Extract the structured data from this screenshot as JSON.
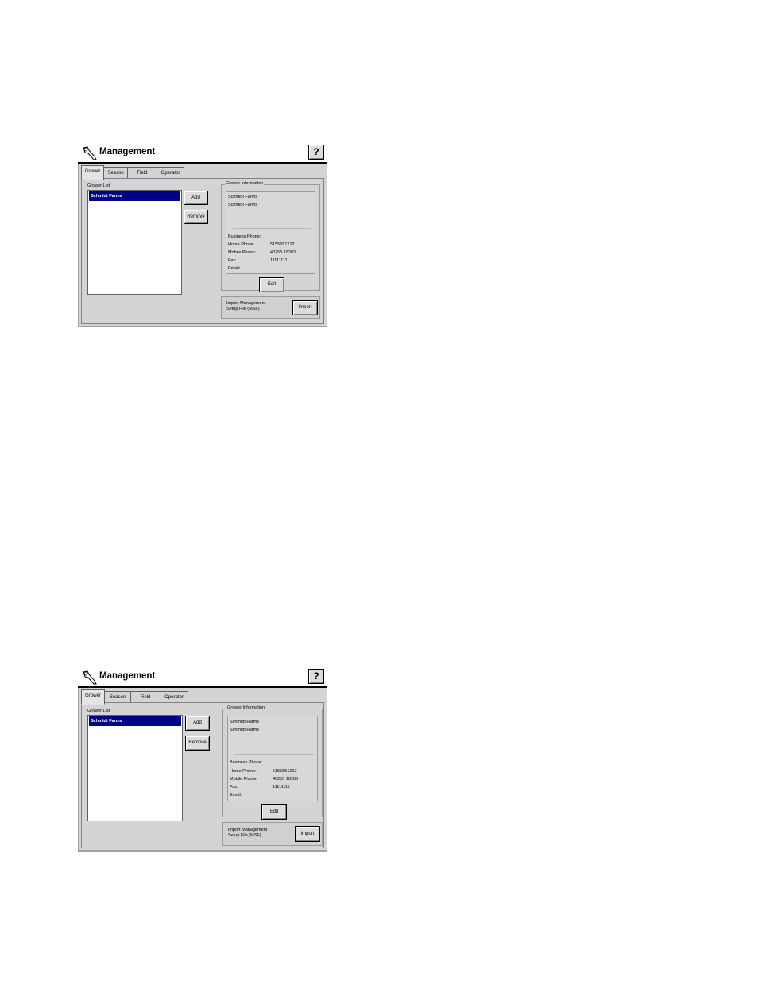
{
  "screens": [
    {
      "title": "Management",
      "help_label": "?",
      "tabs": [
        "Grower",
        "Season",
        "Field",
        "Operator"
      ],
      "grower_list_label": "Grower List",
      "grower_list": [
        "Schmidt Farms"
      ],
      "add_label": "Add",
      "remove_label": "Remove",
      "grower_info_label": "Grower Information",
      "info_name_1": "Schmidt Farms",
      "info_name_2": "Schmidt Farms",
      "business_phone_label": "Business Phone:",
      "home_phone_label": "Home Phone:",
      "home_phone_value": "5155551212",
      "mobile_phone_label": "Mobile Phone:",
      "mobile_phone_value": "40255 18283",
      "fax_label": "Fax:",
      "fax_value": "11111111",
      "email_label": "Email:",
      "edit_label": "Edit",
      "import_text_1": "Import Management",
      "import_text_2": "Setup File (MSF)",
      "import_label": "Import"
    },
    {
      "title": "Management",
      "help_label": "?",
      "tabs": [
        "Grower",
        "Season",
        "Field",
        "Operator"
      ],
      "grower_list_label": "Grower List",
      "grower_list": [
        "Schmidt Farms"
      ],
      "add_label": "Add",
      "remove_label": "Remove",
      "grower_info_label": "Grower Information",
      "info_name_1": "Schmidt Farms",
      "info_name_2": "Schmidt Farms",
      "business_phone_label": "Business Phone:",
      "home_phone_label": "Home Phone:",
      "home_phone_value": "5155551212",
      "mobile_phone_label": "Mobile Phone:",
      "mobile_phone_value": "40255 18283",
      "fax_label": "Fax:",
      "fax_value": "11111111",
      "email_label": "Email:",
      "edit_label": "Edit",
      "import_text_1": "Import Management",
      "import_text_2": "Setup File (MSF)",
      "import_label": "Import"
    }
  ]
}
